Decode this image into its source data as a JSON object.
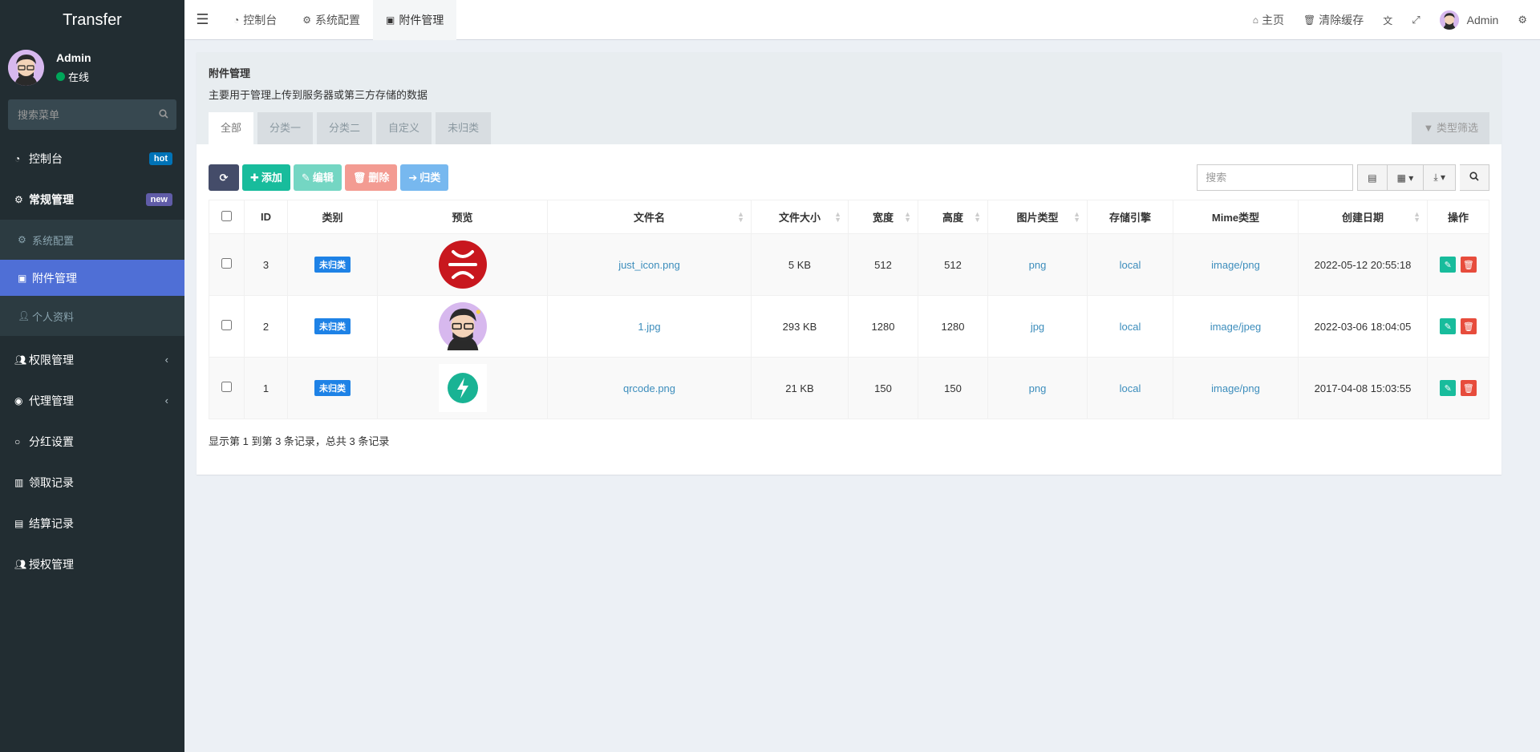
{
  "app": {
    "name": "Transfer"
  },
  "user": {
    "name": "Admin",
    "status": "在线"
  },
  "sidebar": {
    "search_placeholder": "搜索菜单",
    "items": [
      {
        "label": "控制台",
        "badge": "hot"
      },
      {
        "label": "常规管理",
        "badge": "new"
      },
      {
        "label": "系统配置"
      },
      {
        "label": "附件管理"
      },
      {
        "label": "个人资料"
      },
      {
        "label": "权限管理"
      },
      {
        "label": "代理管理"
      },
      {
        "label": "分红设置"
      },
      {
        "label": "领取记录"
      },
      {
        "label": "结算记录"
      },
      {
        "label": "授权管理"
      }
    ]
  },
  "topbar": {
    "tabs": [
      {
        "label": "控制台"
      },
      {
        "label": "系统配置"
      },
      {
        "label": "附件管理"
      }
    ],
    "home": "主页",
    "clear_cache": "清除缓存",
    "admin": "Admin"
  },
  "panel": {
    "title": "附件管理",
    "description": "主要用于管理上传到服务器或第三方存储的数据",
    "subtabs": [
      "全部",
      "分类一",
      "分类二",
      "自定义",
      "未归类"
    ],
    "filter": "类型筛选"
  },
  "toolbar": {
    "add": "添加",
    "edit": "编辑",
    "delete": "删除",
    "classify": "归类",
    "search_placeholder": "搜索"
  },
  "table": {
    "headers": [
      "ID",
      "类别",
      "预览",
      "文件名",
      "文件大小",
      "宽度",
      "高度",
      "图片类型",
      "存储引擎",
      "Mime类型",
      "创建日期",
      "操作"
    ],
    "rows": [
      {
        "id": "3",
        "category": "未归类",
        "filename": "just_icon.png",
        "size": "5 KB",
        "width": "512",
        "height": "512",
        "imagetype": "png",
        "storage": "local",
        "mime": "image/png",
        "created": "2022-05-12 20:55:18"
      },
      {
        "id": "2",
        "category": "未归类",
        "filename": "1.jpg",
        "size": "293 KB",
        "width": "1280",
        "height": "1280",
        "imagetype": "jpg",
        "storage": "local",
        "mime": "image/jpeg",
        "created": "2022-03-06 18:04:05"
      },
      {
        "id": "1",
        "category": "未归类",
        "filename": "qrcode.png",
        "size": "21 KB",
        "width": "150",
        "height": "150",
        "imagetype": "png",
        "storage": "local",
        "mime": "image/png",
        "created": "2017-04-08 15:03:55"
      }
    ],
    "footer": "显示第 1 到第 3 条记录，总共 3 条记录"
  }
}
